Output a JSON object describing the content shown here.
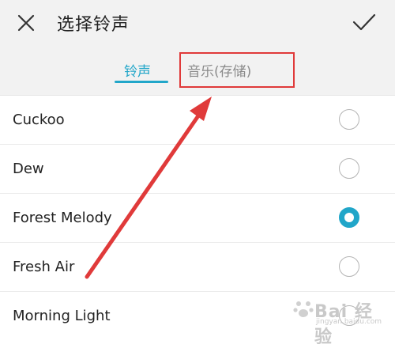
{
  "header": {
    "title": "选择铃声",
    "close_icon": "close-icon",
    "confirm_icon": "checkmark-icon"
  },
  "tabs": [
    {
      "label": "铃声",
      "active": true
    },
    {
      "label": "音乐(存储)",
      "active": false
    }
  ],
  "ringtones": [
    {
      "label": "Cuckoo",
      "selected": false
    },
    {
      "label": "Dew",
      "selected": false
    },
    {
      "label": "Forest Melody",
      "selected": true
    },
    {
      "label": "Fresh Air",
      "selected": false
    },
    {
      "label": "Morning Light",
      "selected": false
    }
  ],
  "watermark": {
    "text": "Bai 经验",
    "sub": "jingyan.baidu.com"
  },
  "colors": {
    "accent": "#21a6c9",
    "annotation": "#e03a3a",
    "header_bg": "#f2f2f2"
  }
}
